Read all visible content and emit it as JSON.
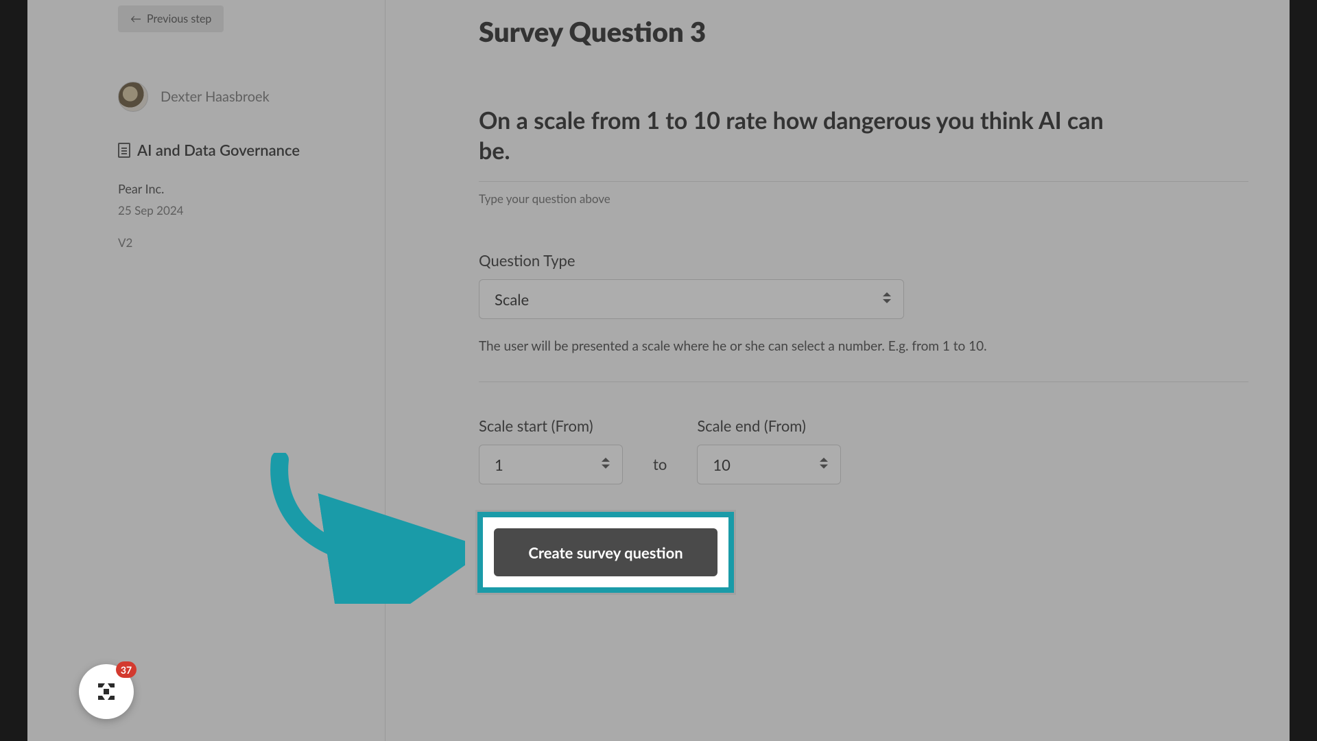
{
  "sidebar": {
    "prev_label": "Previous step",
    "user_name": "Dexter Haasbroek",
    "doc_title": "AI and Data Governance",
    "company": "Pear Inc.",
    "date": "25 Sep 2024",
    "version": "V2"
  },
  "main": {
    "title": "Survey Question 3",
    "question_text": "On a scale from 1 to 10 rate how dangerous you think AI can be.",
    "question_hint": "Type your question above",
    "type_label": "Question Type",
    "type_value": "Scale",
    "type_help": "The user will be presented a scale where he or she can select a number. E.g. from 1 to 10.",
    "scale_start_label": "Scale start (From)",
    "scale_start_value": "1",
    "to_label": "to",
    "scale_end_label": "Scale end (From)",
    "scale_end_value": "10",
    "create_label": "Create survey question"
  },
  "fab": {
    "badge_count": "37"
  },
  "colors": {
    "accent": "#1a9ba8",
    "button_dark": "#4a4a4a",
    "badge": "#d33a2f"
  }
}
